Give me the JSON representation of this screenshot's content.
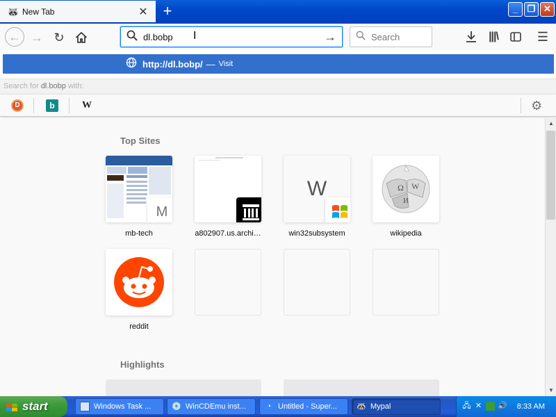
{
  "window": {
    "tab_title": "New Tab",
    "tab_close_glyph": "✕",
    "new_tab_glyph": "+",
    "controls": {
      "minimize": "_",
      "maximize": "❐",
      "close": "✕"
    }
  },
  "navbar": {
    "url_value": "dl.bobp",
    "search_placeholder": "Search",
    "icons": [
      "back-icon",
      "forward-icon",
      "reload-icon",
      "home-icon",
      "downloads-icon",
      "library-icon",
      "sidebar-icon",
      "menu-icon"
    ]
  },
  "urlbar_dropdown": {
    "suggestion_url": "http://dl.bobp/",
    "suggestion_sep": "—",
    "suggestion_action": "Visit",
    "search_for_prefix": "Search for",
    "search_for_term": "dl.bobp",
    "search_for_suffix": "with:",
    "engines": [
      "DuckDuckGo",
      "Bing",
      "Wikipedia"
    ]
  },
  "content": {
    "top_sites_title": "Top Sites",
    "highlights_title": "Highlights",
    "top_sites": [
      {
        "label": "mb-tech",
        "badge": "M"
      },
      {
        "label": "a802907.us.archi…",
        "badge": "🏛"
      },
      {
        "label": "win32subsystem",
        "letter": "W",
        "badge": "⊞"
      },
      {
        "label": "wikipedia"
      },
      {
        "label": "reddit"
      }
    ]
  },
  "taskbar": {
    "start_label": "start",
    "tasks": [
      {
        "label": "Windows Task ..."
      },
      {
        "label": "WinCDEmu inst..."
      },
      {
        "label": "Untitled - Super..."
      },
      {
        "label": "Mypal",
        "active": true
      }
    ],
    "clock": "8:33 AM"
  },
  "colors": {
    "accent": "#0a84ff",
    "suggestion_bg": "#3370cc",
    "titlebar": "#0047c8",
    "taskbar": "#245dd7",
    "start_green": "#3c9b3c",
    "reddit_orange": "#ff4500"
  }
}
